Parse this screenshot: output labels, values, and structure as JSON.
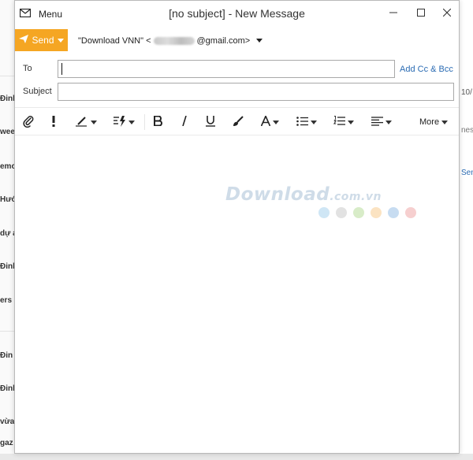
{
  "background": {
    "left_fragments": [
      "Đinh",
      "wee",
      "emo",
      "Hướ",
      "dự á",
      "Đinh",
      "ers U",
      "Đin",
      "Đinh",
      "vừa",
      "gaz"
    ],
    "right_fragments": [
      "10/",
      "ness",
      "Send"
    ]
  },
  "window": {
    "title": "[no subject] - New Message",
    "menu_label": "Menu"
  },
  "sender": {
    "send_label": "Send",
    "from_prefix": "\"Download VNN\" <",
    "from_suffix": "@gmail.com>"
  },
  "to": {
    "label": "To",
    "value": "",
    "placeholder": ""
  },
  "add_cc_bcc": "Add Cc & Bcc",
  "subject": {
    "label": "Subject",
    "value": "",
    "placeholder": ""
  },
  "toolbar": {
    "more_label": "More"
  },
  "watermark": {
    "brand": "Download",
    "domain": ".com.vn",
    "dot_colors": [
      "#cfe6f5",
      "#e2e2e2",
      "#d8ecc8",
      "#fbe3c2",
      "#c7dcf1",
      "#f6cfcf"
    ]
  },
  "colors": {
    "send_button": "#f5a623",
    "link": "#2a6bb3"
  }
}
